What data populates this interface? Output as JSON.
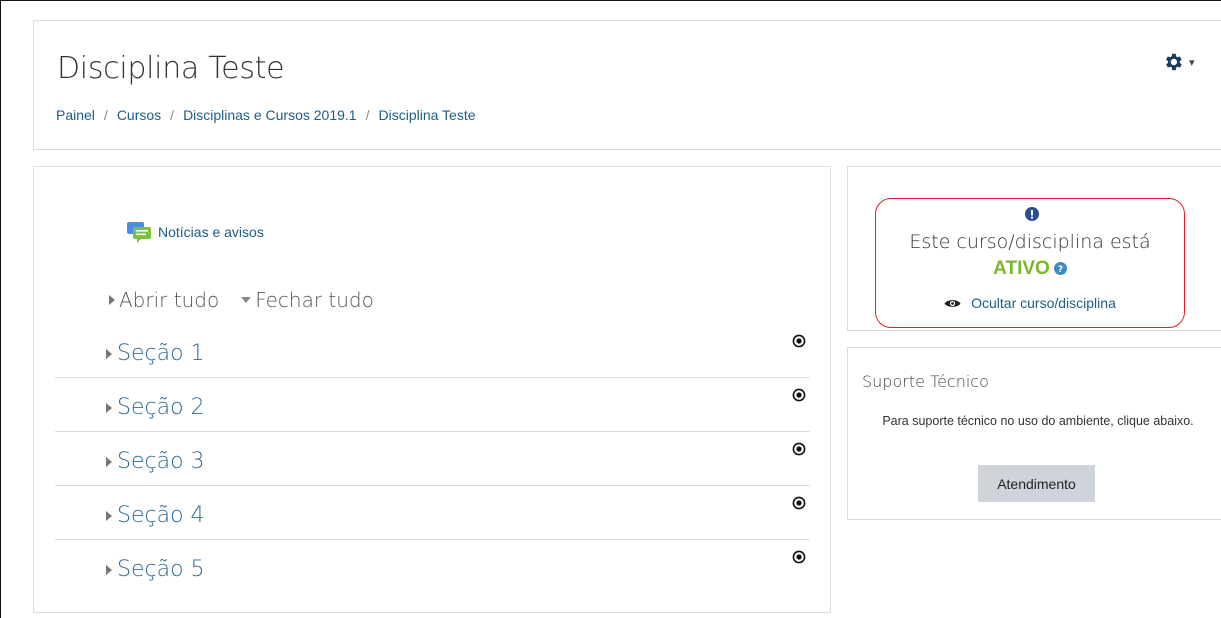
{
  "header": {
    "title": "Disciplina Teste",
    "breadcrumb": [
      "Painel",
      "Cursos",
      "Disciplinas e Cursos 2019.1",
      "Disciplina Teste"
    ],
    "settings_icon": "gear-icon"
  },
  "course": {
    "news_link": "Notícias e avisos",
    "expand_all": "Abrir tudo",
    "collapse_all": "Fechar tudo",
    "sections": [
      {
        "name": "Seção 1"
      },
      {
        "name": "Seção 2"
      },
      {
        "name": "Seção 3"
      },
      {
        "name": "Seção 4"
      },
      {
        "name": "Seção 5"
      }
    ]
  },
  "status_block": {
    "line1": "Este curso/disciplina está",
    "status": "ATIVO",
    "hide_link": "Ocultar curso/disciplina",
    "status_color": "#78b82a",
    "highlight_color": "#e0202a"
  },
  "support": {
    "title": "Suporte Técnico",
    "text": "Para suporte técnico no uso do ambiente, clique abaixo.",
    "button": "Atendimento"
  },
  "colors": {
    "link": "#1f5c84",
    "section": "#2f6b94",
    "info_icon": "#2b4e8c"
  }
}
